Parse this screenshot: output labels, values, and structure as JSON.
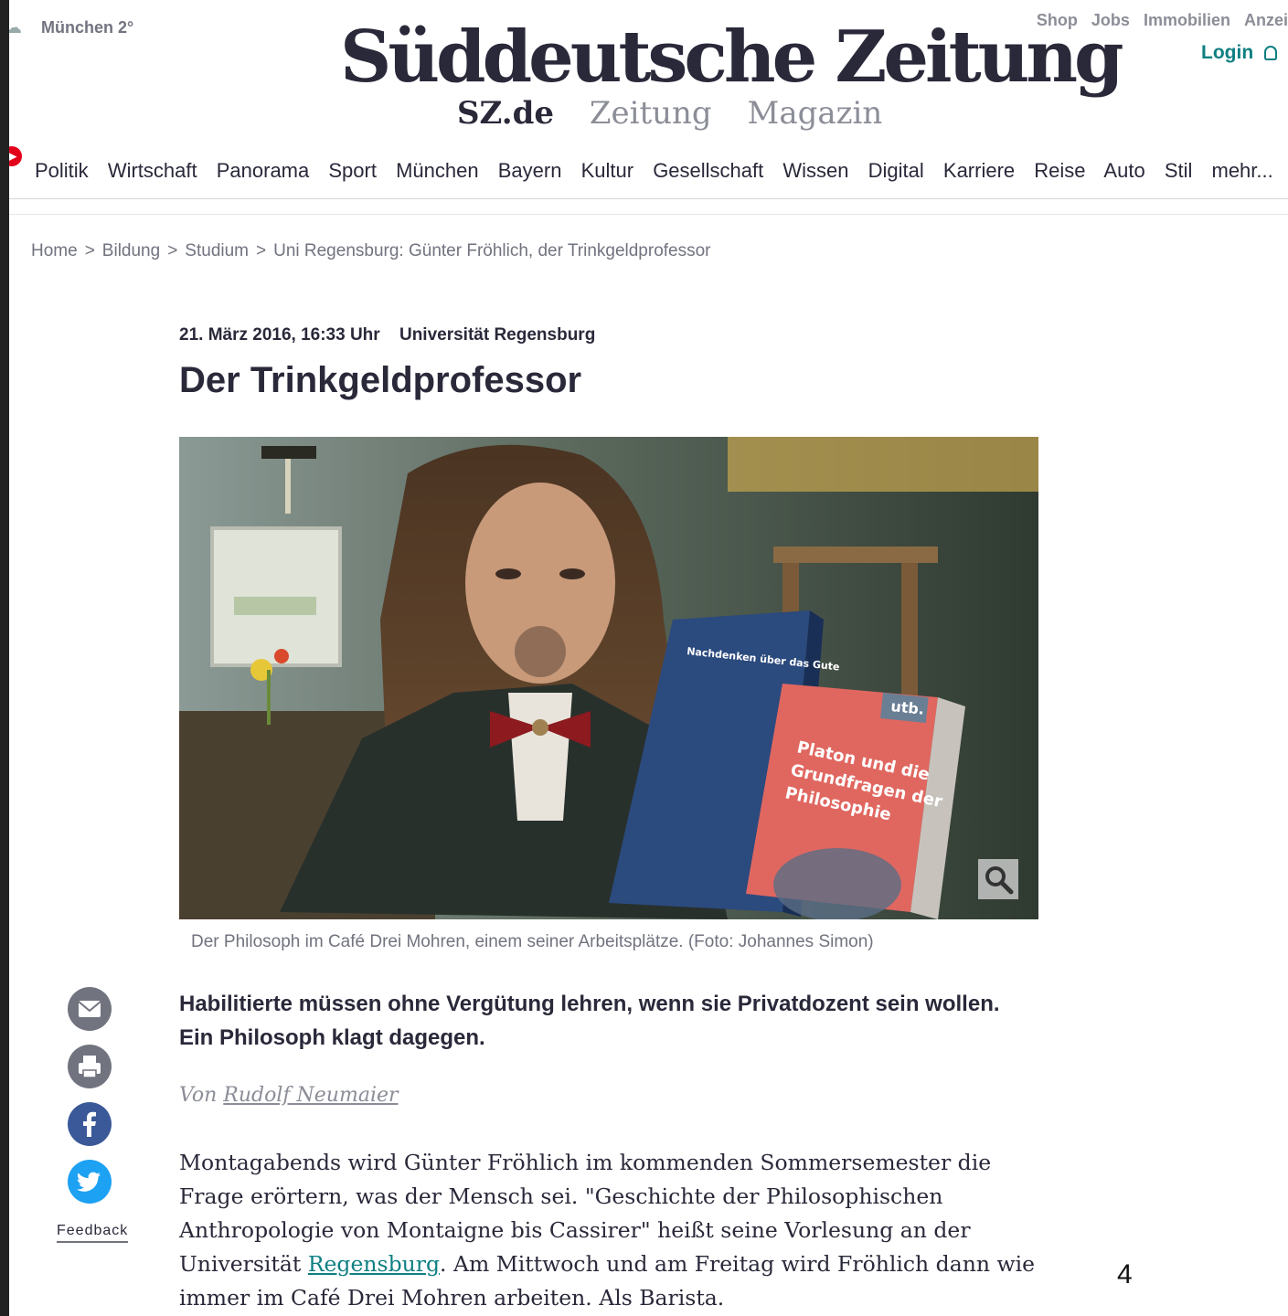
{
  "header": {
    "weather": "München 2°",
    "logo": "Süddeutsche Zeitung",
    "subnav": [
      "SZ.de",
      "Zeitung",
      "Magazin"
    ],
    "toplinks": [
      "Shop",
      "Jobs",
      "Immobilien",
      "Anzei"
    ],
    "login": "Login"
  },
  "nav": [
    "Politik",
    "Wirtschaft",
    "Panorama",
    "Sport",
    "München",
    "Bayern",
    "Kultur",
    "Gesellschaft",
    "Wissen",
    "Digital",
    "Karriere",
    "Reise",
    "Auto",
    "Stil",
    "mehr..."
  ],
  "breadcrumb": [
    "Home",
    "Bildung",
    "Studium",
    "Uni Regensburg: Günter Fröhlich, der Trinkgeldprofessor"
  ],
  "article": {
    "date": "21. März 2016, 16:33 Uhr",
    "keyword": "Universität Regensburg",
    "headline": "Der Trinkgeldprofessor",
    "photo": {
      "book1_title": "Nachdenken über das Gute",
      "book2_publisher": "utb.",
      "book2_title_1": "Platon und die",
      "book2_title_2": "Grundfragen der",
      "book2_title_3": "Philosophie"
    },
    "caption": "Der Philosoph im Café Drei Mohren, einem seiner Arbeitsplätze. (Foto: Johannes Simon)",
    "teaser": "Habilitierte müssen ohne Vergütung lehren, wenn sie Privatdozent sein wollen. Ein Philosoph klagt dagegen.",
    "byline_prefix": "Von",
    "author": "Rudolf Neumaier",
    "body_part1": "Montagabends wird Günter Fröhlich im kommenden Sommersemester die Frage erörtern, was der Mensch sei. \"Geschichte der Philosophischen Anthropologie von Montaigne bis Cassirer\" heißt seine Vorlesung an der Universität ",
    "body_link": "Regensburg",
    "body_part2": ". Am Mittwoch und am Freitag wird Fröhlich dann wie immer im Café Drei Mohren arbeiten. Als Barista."
  },
  "share": {
    "feedback": "Feedback"
  },
  "page_number": "4",
  "colors": {
    "accent": "#0f7f82",
    "text": "#29293a",
    "muted": "#71737f",
    "facebook": "#3b5998",
    "twitter": "#1da1f2"
  }
}
